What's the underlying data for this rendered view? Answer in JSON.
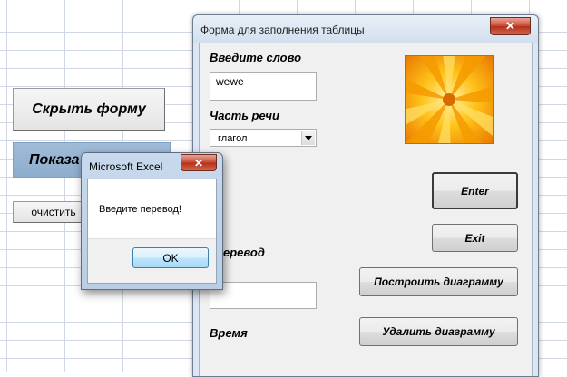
{
  "sheet": {
    "buttons": {
      "hide_form": "Скрыть форму",
      "show_form": "Показа",
      "clear": "очистить"
    }
  },
  "userform": {
    "title": "Форма для заполнения таблицы",
    "close_symbol": "✕",
    "labels": {
      "word": "Введите слово",
      "part_of_speech": "Часть речи",
      "translation": "еревод",
      "time": "Время"
    },
    "word_input_value": "wewe",
    "part_of_speech_value": "глагол",
    "translation_input_value": "",
    "buttons": {
      "enter": "Enter",
      "exit": "Exit",
      "build_chart": "Построить диаграмму",
      "delete_chart": "Удалить диаграмму"
    },
    "image": "orange-flower-photo"
  },
  "msgbox": {
    "title": "Microsoft Excel",
    "close_symbol": "✕",
    "message": "Введите перевод!",
    "ok_label": "OK"
  },
  "colors": {
    "form_titlebar": "#dce6f2",
    "close_button": "#c7452e",
    "show_button_fill": "#9fbbd8"
  }
}
